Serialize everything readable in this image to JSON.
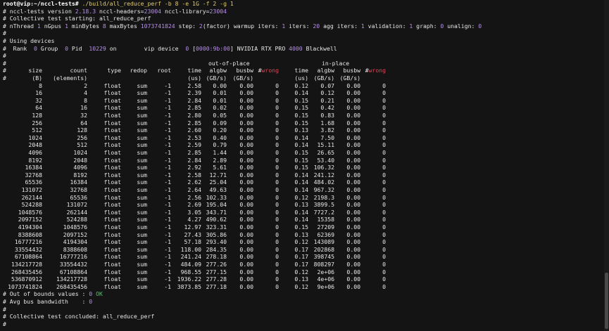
{
  "prompt": "root@vip:~/nccl-tests#",
  "command": " ./build/all_reduce_perf -b 8 -e 1G -f 2 -g 1",
  "header_lines": [
    [
      [
        "# nccl-tests version ",
        ""
      ],
      [
        "2.18.3",
        "num"
      ],
      [
        " nccl-headers=",
        ""
      ],
      [
        "23004",
        "num"
      ],
      [
        " nccl-library=",
        ""
      ],
      [
        "23004",
        "num"
      ]
    ],
    [
      [
        "# Collective test starting: all_reduce_perf",
        ""
      ]
    ],
    [
      [
        "# nThread ",
        ""
      ],
      [
        "1",
        "num"
      ],
      [
        " nGpus ",
        ""
      ],
      [
        "1",
        "num"
      ],
      [
        " minBytes ",
        ""
      ],
      [
        "8",
        "num"
      ],
      [
        " maxBytes ",
        ""
      ],
      [
        "1073741824",
        "num"
      ],
      [
        " step: ",
        ""
      ],
      [
        "2",
        "num"
      ],
      [
        "(factor) warmup iters: ",
        ""
      ],
      [
        "1",
        "num"
      ],
      [
        " iters: ",
        ""
      ],
      [
        "20",
        "num"
      ],
      [
        " agg iters: ",
        ""
      ],
      [
        "1",
        "num"
      ],
      [
        " validation: ",
        ""
      ],
      [
        "1",
        "num"
      ],
      [
        " graph: ",
        ""
      ],
      [
        "0",
        "num"
      ],
      [
        " unalign: ",
        ""
      ],
      [
        "0",
        "num"
      ]
    ],
    [
      [
        "#",
        ""
      ]
    ],
    [
      [
        "# Using devices",
        ""
      ]
    ],
    [
      [
        "#  Rank  ",
        ""
      ],
      [
        "0",
        "num"
      ],
      [
        " Group  ",
        ""
      ],
      [
        "0",
        "num"
      ],
      [
        " Pid  ",
        ""
      ],
      [
        "10229",
        "num"
      ],
      [
        " on        vip device  ",
        ""
      ],
      [
        "0",
        "num"
      ],
      [
        " [",
        ""
      ],
      [
        "0000:9b:00",
        "num"
      ],
      [
        "] NVIDIA RTX PRO ",
        ""
      ],
      [
        "4000",
        "num"
      ],
      [
        " Blackwell",
        ""
      ]
    ],
    [
      [
        "#",
        ""
      ]
    ]
  ],
  "section_headers": {
    "out_of_place": "out-of-place",
    "in_place": "in-place"
  },
  "column_headers_1": [
    "size",
    "count",
    "type",
    "redop",
    "root",
    "time",
    "algbw",
    "busbw",
    "#wrong",
    "time",
    "algbw",
    "busbw",
    "#wrong"
  ],
  "column_headers_2": [
    "(B)",
    "(elements)",
    "",
    "",
    "",
    "(us)",
    "(GB/s)",
    "(GB/s)",
    "",
    "(us)",
    "(GB/s)",
    "(GB/s)",
    ""
  ],
  "rows": [
    [
      "8",
      "2",
      "float",
      "sum",
      "-1",
      "2.58",
      "0.00",
      "0.00",
      "0",
      "0.12",
      "0.07",
      "0.00",
      "0"
    ],
    [
      "16",
      "4",
      "float",
      "sum",
      "-1",
      "2.39",
      "0.01",
      "0.00",
      "0",
      "0.14",
      "0.12",
      "0.00",
      "0"
    ],
    [
      "32",
      "8",
      "float",
      "sum",
      "-1",
      "2.84",
      "0.01",
      "0.00",
      "0",
      "0.15",
      "0.21",
      "0.00",
      "0"
    ],
    [
      "64",
      "16",
      "float",
      "sum",
      "-1",
      "2.85",
      "0.02",
      "0.00",
      "0",
      "0.15",
      "0.42",
      "0.00",
      "0"
    ],
    [
      "128",
      "32",
      "float",
      "sum",
      "-1",
      "2.80",
      "0.05",
      "0.00",
      "0",
      "0.15",
      "0.83",
      "0.00",
      "0"
    ],
    [
      "256",
      "64",
      "float",
      "sum",
      "-1",
      "2.85",
      "0.09",
      "0.00",
      "0",
      "0.15",
      "1.68",
      "0.00",
      "0"
    ],
    [
      "512",
      "128",
      "float",
      "sum",
      "-1",
      "2.60",
      "0.20",
      "0.00",
      "0",
      "0.13",
      "3.82",
      "0.00",
      "0"
    ],
    [
      "1024",
      "256",
      "float",
      "sum",
      "-1",
      "2.53",
      "0.40",
      "0.00",
      "0",
      "0.14",
      "7.50",
      "0.00",
      "0"
    ],
    [
      "2048",
      "512",
      "float",
      "sum",
      "-1",
      "2.59",
      "0.79",
      "0.00",
      "0",
      "0.14",
      "15.11",
      "0.00",
      "0"
    ],
    [
      "4096",
      "1024",
      "float",
      "sum",
      "-1",
      "2.85",
      "1.44",
      "0.00",
      "0",
      "0.15",
      "26.65",
      "0.00",
      "0"
    ],
    [
      "8192",
      "2048",
      "float",
      "sum",
      "-1",
      "2.84",
      "2.89",
      "0.00",
      "0",
      "0.15",
      "53.40",
      "0.00",
      "0"
    ],
    [
      "16384",
      "4096",
      "float",
      "sum",
      "-1",
      "2.92",
      "5.61",
      "0.00",
      "0",
      "0.15",
      "106.32",
      "0.00",
      "0"
    ],
    [
      "32768",
      "8192",
      "float",
      "sum",
      "-1",
      "2.58",
      "12.71",
      "0.00",
      "0",
      "0.14",
      "241.12",
      "0.00",
      "0"
    ],
    [
      "65536",
      "16384",
      "float",
      "sum",
      "-1",
      "2.62",
      "25.04",
      "0.00",
      "0",
      "0.14",
      "484.02",
      "0.00",
      "0"
    ],
    [
      "131072",
      "32768",
      "float",
      "sum",
      "-1",
      "2.64",
      "49.63",
      "0.00",
      "0",
      "0.14",
      "967.32",
      "0.00",
      "0"
    ],
    [
      "262144",
      "65536",
      "float",
      "sum",
      "-1",
      "2.56",
      "102.33",
      "0.00",
      "0",
      "0.12",
      "2198.3",
      "0.00",
      "0"
    ],
    [
      "524288",
      "131072",
      "float",
      "sum",
      "-1",
      "2.69",
      "195.04",
      "0.00",
      "0",
      "0.13",
      "3899.5",
      "0.00",
      "0"
    ],
    [
      "1048576",
      "262144",
      "float",
      "sum",
      "-1",
      "3.05",
      "343.71",
      "0.00",
      "0",
      "0.14",
      "7727.2",
      "0.00",
      "0"
    ],
    [
      "2097152",
      "524288",
      "float",
      "sum",
      "-1",
      "4.27",
      "490.62",
      "0.00",
      "0",
      "0.14",
      "15358",
      "0.00",
      "0"
    ],
    [
      "4194304",
      "1048576",
      "float",
      "sum",
      "-1",
      "12.97",
      "323.31",
      "0.00",
      "0",
      "0.15",
      "27209",
      "0.00",
      "0"
    ],
    [
      "8388608",
      "2097152",
      "float",
      "sum",
      "-1",
      "27.43",
      "305.86",
      "0.00",
      "0",
      "0.13",
      "62369",
      "0.00",
      "0"
    ],
    [
      "16777216",
      "4194304",
      "float",
      "sum",
      "-1",
      "57.18",
      "293.40",
      "0.00",
      "0",
      "0.12",
      "143089",
      "0.00",
      "0"
    ],
    [
      "33554432",
      "8388608",
      "float",
      "sum",
      "-1",
      "118.00",
      "284.35",
      "0.00",
      "0",
      "0.17",
      "202868",
      "0.00",
      "0"
    ],
    [
      "67108864",
      "16777216",
      "float",
      "sum",
      "-1",
      "241.24",
      "278.18",
      "0.00",
      "0",
      "0.17",
      "398745",
      "0.00",
      "0"
    ],
    [
      "134217728",
      "33554432",
      "float",
      "sum",
      "-1",
      "484.09",
      "277.26",
      "0.00",
      "0",
      "0.17",
      "808297",
      "0.00",
      "0"
    ],
    [
      "268435456",
      "67108864",
      "float",
      "sum",
      "-1",
      "968.55",
      "277.15",
      "0.00",
      "0",
      "0.12",
      "2e+06",
      "0.00",
      "0"
    ],
    [
      "536870912",
      "134217728",
      "float",
      "sum",
      "-1",
      "1936.22",
      "277.28",
      "0.00",
      "0",
      "0.13",
      "4e+06",
      "0.00",
      "0"
    ],
    [
      "1073741824",
      "268435456",
      "float",
      "sum",
      "-1",
      "3873.85",
      "277.18",
      "0.00",
      "0",
      "0.12",
      "9e+06",
      "0.00",
      "0"
    ]
  ],
  "footer_lines": [
    [
      [
        "# Out of bounds values : ",
        ""
      ],
      [
        "0",
        "num"
      ],
      [
        " ",
        ""
      ],
      [
        "OK",
        "ok"
      ]
    ],
    [
      [
        "# Avg bus bandwidth    : ",
        ""
      ],
      [
        "0",
        "num"
      ]
    ],
    [
      [
        "#",
        ""
      ]
    ],
    [
      [
        "# Collective test concluded: all_reduce_perf",
        ""
      ]
    ],
    [
      [
        "#",
        ""
      ]
    ]
  ],
  "colors": {
    "background": "#141414",
    "text": "#e8e8e8",
    "number": "#b58ee6",
    "command": "#e3cd6a",
    "wrong": "#e0465a",
    "ok": "#58c268"
  }
}
